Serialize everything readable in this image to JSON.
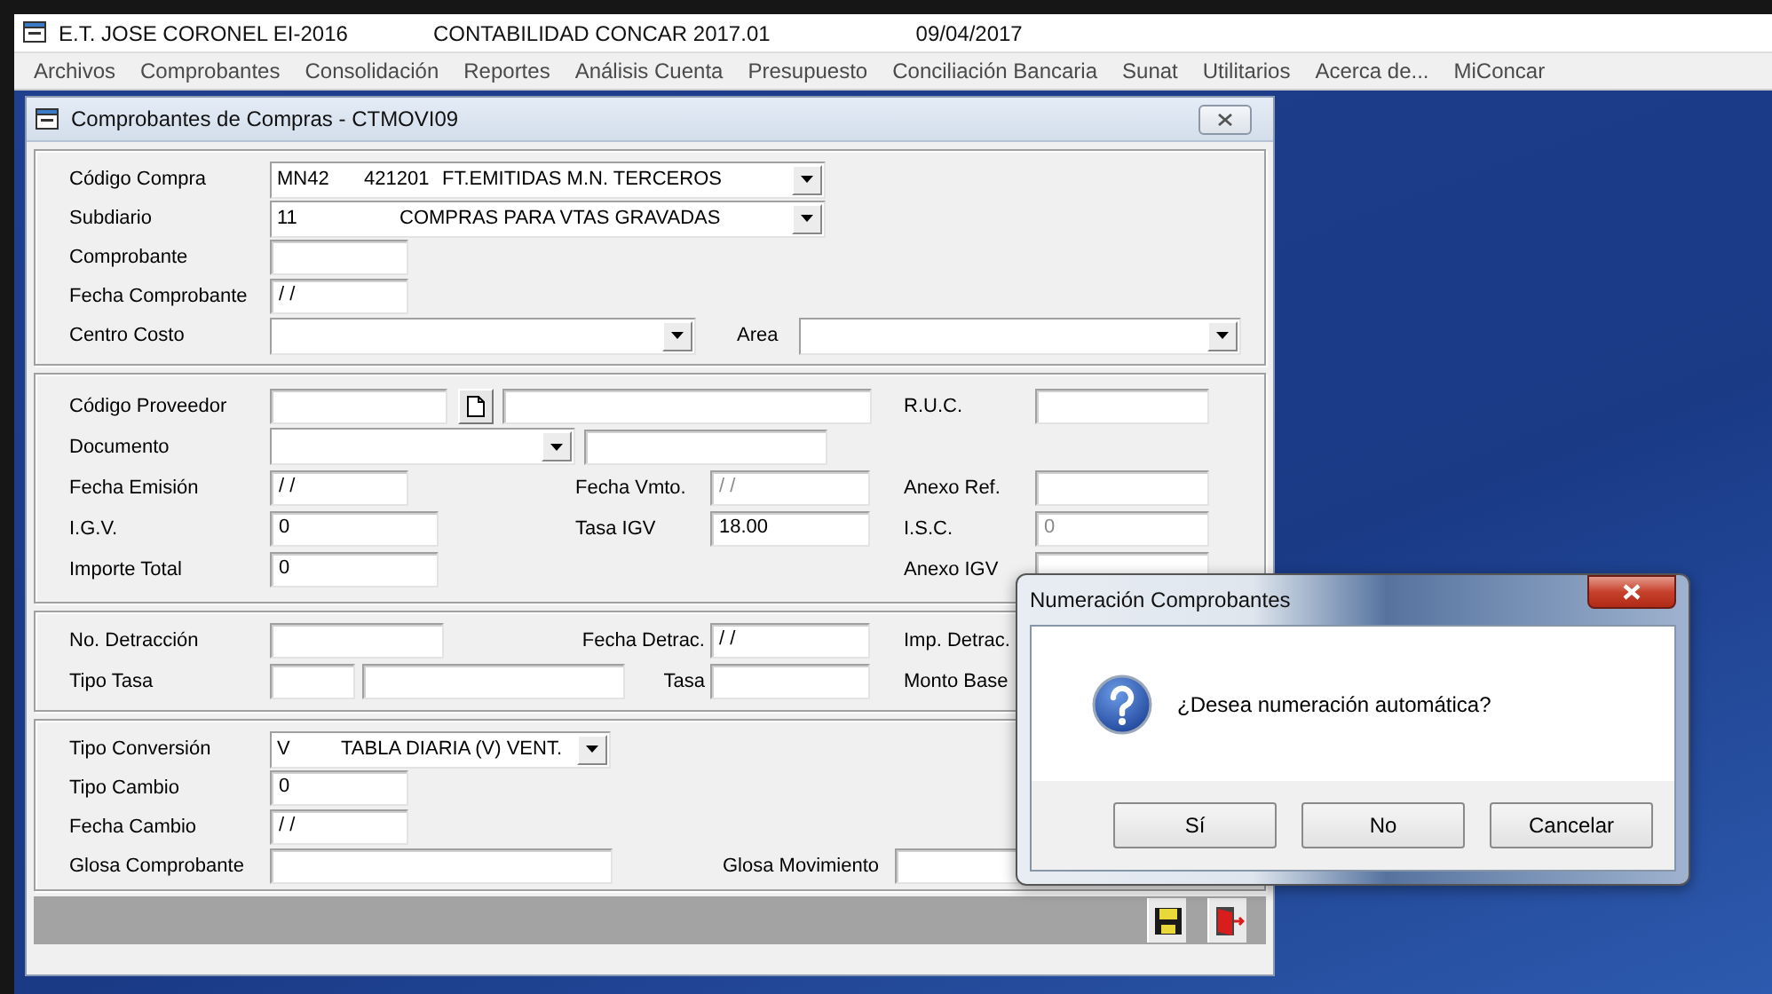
{
  "app_title": {
    "parts": [
      "E.T. JOSE CORONEL EI-2016",
      "CONTABILIDAD CONCAR 2017.01",
      "09/04/2017"
    ]
  },
  "menu": [
    "Archivos",
    "Comprobantes",
    "Consolidación",
    "Reportes",
    "Análisis Cuenta",
    "Presupuesto",
    "Conciliación Bancaria",
    "Sunat",
    "Utilitarios",
    "Acerca de...",
    "MiConcar"
  ],
  "form": {
    "title": "Comprobantes de Compras - CTMOVI09",
    "header": {
      "codigo_compra": {
        "label": "Código Compra",
        "value": [
          "MN42",
          "421201",
          "FT.EMITIDAS M.N. TERCEROS"
        ]
      },
      "subdiario": {
        "label": "Subdiario",
        "value": [
          "11",
          "COMPRAS PARA VTAS GRAVADAS"
        ]
      },
      "comprobante": {
        "label": "Comprobante"
      },
      "fecha_comprobante": {
        "label": "Fecha Comprobante",
        "value": "/ /",
        "disabled": false
      },
      "centro_costo": {
        "label": "Centro Costo"
      },
      "area": {
        "label": "Area"
      }
    },
    "proveedor": {
      "codigo_proveedor": {
        "label": "Código Proveedor"
      },
      "ruc": {
        "label": "R.U.C."
      },
      "documento": {
        "label": "Documento"
      },
      "fecha_emision": {
        "label": "Fecha Emisión",
        "value": "/ /",
        "disabled": false
      },
      "fecha_vmto": {
        "label": "Fecha Vmto.",
        "value": "/ /",
        "disabled": true
      },
      "anexo_ref": {
        "label": "Anexo Ref."
      },
      "igv": {
        "label": "I.G.V.",
        "value": "0",
        "disabled": false
      },
      "tasa_igv": {
        "label": "Tasa IGV",
        "value": "18.00",
        "disabled": false
      },
      "isc": {
        "label": "I.S.C.",
        "value": "0",
        "disabled": true
      },
      "importe_total": {
        "label": "Importe Total",
        "value": "0",
        "disabled": false
      },
      "anexo_igv": {
        "label": "Anexo IGV"
      }
    },
    "detraccion": {
      "no_detraccion": {
        "label": "No. Detracción"
      },
      "fecha_detrac": {
        "label": "Fecha Detrac.",
        "value": "/ /",
        "disabled": false
      },
      "imp_detrac": {
        "label": "Imp. Detrac."
      },
      "tipo_tasa": {
        "label": "Tipo Tasa"
      },
      "tasa": {
        "label": "Tasa"
      },
      "monto_base": {
        "label": "Monto Base"
      }
    },
    "conversion": {
      "tipo_conversion": {
        "label": "Tipo Conversión",
        "value": [
          "V",
          "TABLA DIARIA (V) VENT."
        ]
      },
      "tipo_cambio": {
        "label": "Tipo Cambio",
        "value": "0",
        "disabled": false
      },
      "fecha_cambio": {
        "label": "Fecha Cambio",
        "value": "/ /",
        "disabled": false
      },
      "glosa_comprobante": {
        "label": "Glosa Comprobante"
      },
      "glosa_movimiento": {
        "label": "Glosa Movimiento"
      }
    }
  },
  "dialog": {
    "title": "Numeración Comprobantes",
    "message": "¿Desea numeración automática?",
    "buttons": [
      "Sí",
      "No",
      "Cancelar"
    ]
  }
}
